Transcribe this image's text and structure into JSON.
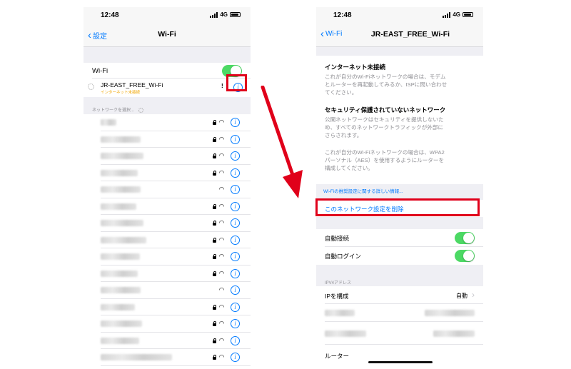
{
  "left": {
    "status_time": "12:48",
    "network_type": "4G",
    "back_label": "設定",
    "title": "Wi-Fi",
    "wifi_label": "Wi-Fi",
    "wifi_on": true,
    "connected_ssid": "JR-EAST_FREE_Wi-Fi",
    "connected_status": "インターネット未接続",
    "connected_warning": "!",
    "choose_network_header": "ネットワークを選択...",
    "networks": [
      {
        "locked": true
      },
      {
        "locked": true
      },
      {
        "locked": true
      },
      {
        "locked": true
      },
      {
        "locked": false
      },
      {
        "locked": true
      },
      {
        "locked": true
      },
      {
        "locked": true
      },
      {
        "locked": true
      },
      {
        "locked": true
      },
      {
        "locked": false
      },
      {
        "locked": true
      },
      {
        "locked": true
      },
      {
        "locked": true
      },
      {
        "locked": true
      }
    ]
  },
  "right": {
    "status_time": "12:48",
    "network_type": "4G",
    "back_label": "Wi-Fi",
    "title": "JR-EAST_FREE_Wi-Fi",
    "no_internet_title": "インターネット未接続",
    "no_internet_line1": "これが自分のWi-Fiネットワークの場合は、モデム",
    "no_internet_line2": "とルーターを再起動してみるか、ISPに問い合わせ",
    "no_internet_line3": "てください。",
    "unsecured_title": "セキュリティ保護されていないネットワーク",
    "unsecured_line1": "公開ネットワークはセキュリティを提供しないた",
    "unsecured_line2": "め、すべてのネットワークトラフィックが外部に",
    "unsecured_line3": "さらされます。",
    "wpa_line1": "これが自分のWi-Fiネットワークの場合は、WPA2",
    "wpa_line2": "パーソナル（AES）を使用するようにルーターを",
    "wpa_line3": "構成してください。",
    "recommended_link": "Wi-Fiの推奨設定に関する詳しい情報...",
    "forget_network": "このネットワーク設定を削除",
    "auto_join_label": "自動接続",
    "auto_join_on": true,
    "auto_login_label": "自動ログイン",
    "auto_login_on": true,
    "ipv4_header": "IPV4アドレス",
    "configure_ip_label": "IPを構成",
    "configure_ip_value": "自動",
    "router_label": "ルーター"
  },
  "colors": {
    "highlight": "#e0001a",
    "accent": "#007aff",
    "toggle_on": "#4cd964",
    "warning": "#ffcc00"
  }
}
